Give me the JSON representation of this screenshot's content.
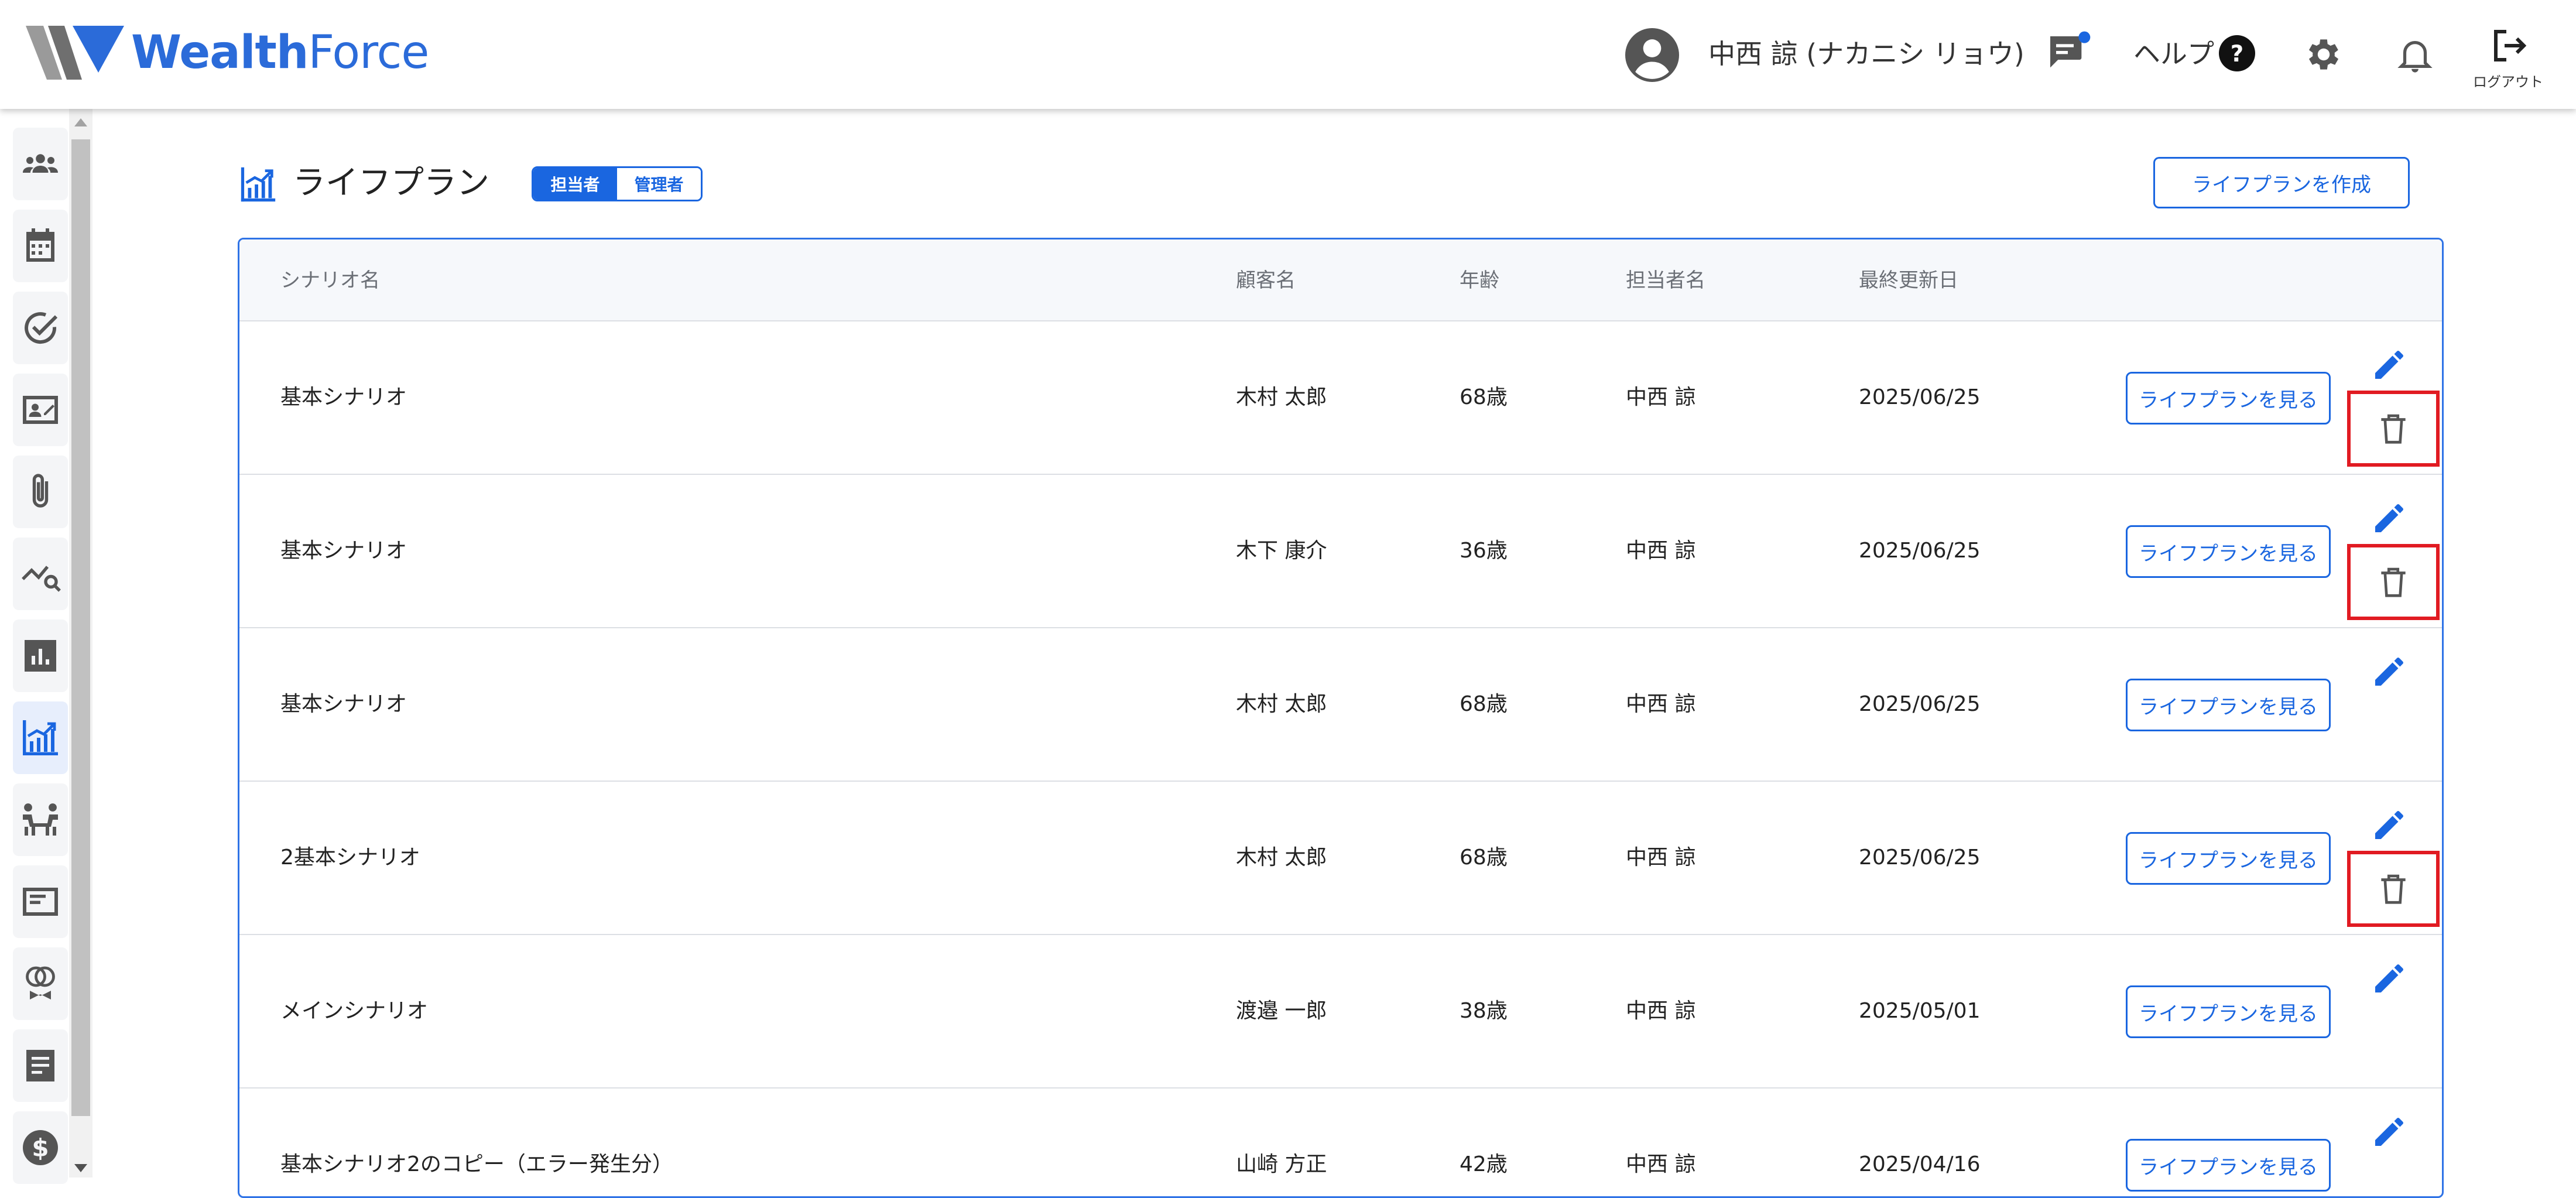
{
  "app": {
    "brand": {
      "bold": "Wealth",
      "light": "Force"
    }
  },
  "header": {
    "user_name": "中西 諒 (ナカニシ リョウ)",
    "help_label": "ヘルプ",
    "logout_label": "ログアウト",
    "icons": [
      "account-icon",
      "chat-icon",
      "help-icon",
      "gear-icon",
      "bell-icon",
      "logout-icon"
    ],
    "chat_badge_color": "#1a66e0"
  },
  "sidebar": {
    "items": [
      {
        "icon": "customers-icon",
        "active": false
      },
      {
        "icon": "calendar-icon",
        "active": false
      },
      {
        "icon": "check-icon",
        "active": false
      },
      {
        "icon": "contact-card-icon",
        "active": false
      },
      {
        "icon": "attachment-icon",
        "active": false
      },
      {
        "icon": "analysis-icon",
        "active": false
      },
      {
        "icon": "report-chart-icon",
        "active": false
      },
      {
        "icon": "lifeplan-icon",
        "active": true
      },
      {
        "icon": "meeting-icon",
        "active": false
      },
      {
        "icon": "document-icon",
        "active": false
      },
      {
        "icon": "insurance-icon",
        "active": false
      },
      {
        "icon": "notes-icon",
        "active": false
      },
      {
        "icon": "money-icon",
        "active": false
      }
    ]
  },
  "page": {
    "title": "ライフプラン",
    "toggle": {
      "on_label": "担当者",
      "off_label": "管理者",
      "selected": "担当者"
    },
    "create_button": "ライフプランを作成"
  },
  "table": {
    "columns": [
      "シナリオ名",
      "顧客名",
      "年齢",
      "担当者名",
      "最終更新日"
    ],
    "view_button": "ライフプランを見る",
    "rows": [
      {
        "scenario": "基本シナリオ",
        "customer": "木村 太郎",
        "age": "68歳",
        "manager": "中西 諒",
        "updated": "2025/06/25",
        "deletable": true
      },
      {
        "scenario": "基本シナリオ",
        "customer": "木下 康介",
        "age": "36歳",
        "manager": "中西 諒",
        "updated": "2025/06/25",
        "deletable": true
      },
      {
        "scenario": "基本シナリオ",
        "customer": "木村 太郎",
        "age": "68歳",
        "manager": "中西 諒",
        "updated": "2025/06/25",
        "deletable": false
      },
      {
        "scenario": "2基本シナリオ",
        "customer": "木村 太郎",
        "age": "68歳",
        "manager": "中西 諒",
        "updated": "2025/06/25",
        "deletable": true
      },
      {
        "scenario": "メインシナリオ",
        "customer": "渡邉 一郎",
        "age": "38歳",
        "manager": "中西 諒",
        "updated": "2025/05/01",
        "deletable": false
      },
      {
        "scenario": "基本シナリオ2のコピー（エラー発生分）",
        "customer": "山崎 方正",
        "age": "42歳",
        "manager": "中西 諒",
        "updated": "2025/04/16",
        "deletable": false
      }
    ]
  },
  "colors": {
    "accent": "#1a66e0",
    "highlight_box": "#e11b22",
    "icon_gray": "#555555"
  }
}
